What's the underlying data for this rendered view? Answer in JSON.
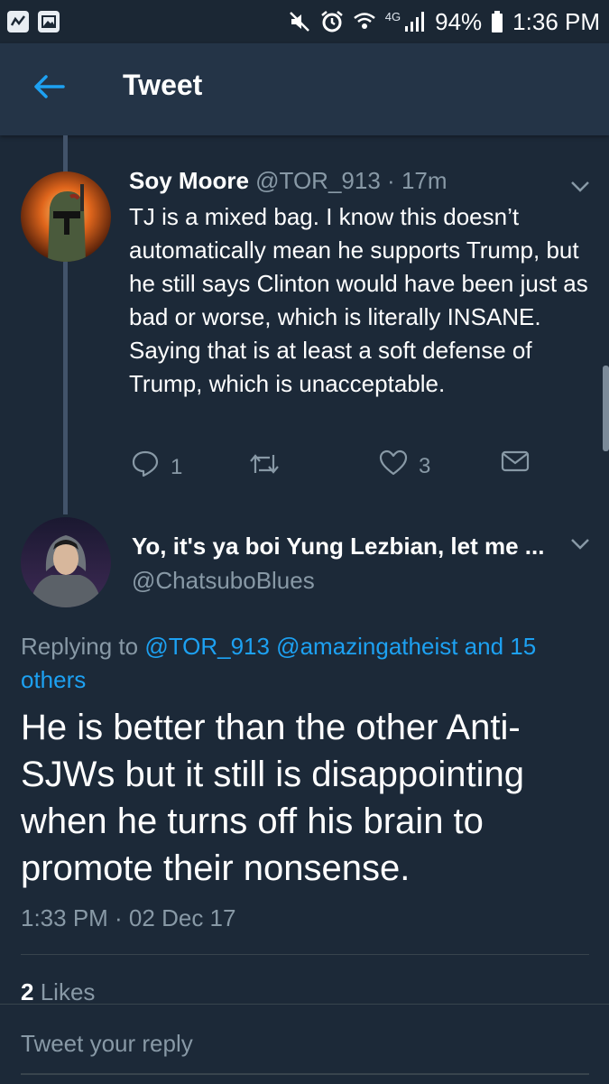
{
  "status_bar": {
    "network": "4G",
    "battery": "94%",
    "time": "1:36 PM",
    "icons": [
      "app-notification-icon",
      "image-notification-icon",
      "mute-icon",
      "alarm-icon",
      "wifi-icon",
      "signal-icon",
      "battery-icon"
    ]
  },
  "header": {
    "title": "Tweet",
    "back_icon": "back-arrow-icon"
  },
  "parent_tweet": {
    "name": "Soy Moore",
    "handle": "@TOR_913",
    "separator": "·",
    "time": "17m",
    "text": "TJ is a mixed bag. I know this doesn’t automatically mean he supports Trump, but he still says Clinton would have been just as bad or worse, which is literally INSANE. Saying that is at least a soft defense of Trump, which is unacceptable.",
    "reply_count": "1",
    "like_count": "3"
  },
  "main_tweet": {
    "name": "Yo, it's ya boi Yung Lezbian, let me ...",
    "handle": "@ChatsuboBlues",
    "replying_prefix": "Replying to",
    "replying_to": "@TOR_913 @amazingatheist and 15 others",
    "text": "He is better than the other Anti-SJWs but it still is disappointing when he turns off his brain to promote their nonsense.",
    "timestamp": "1:33 PM · 02 Dec 17",
    "likes_count": "2",
    "likes_label": "Likes"
  },
  "reply": {
    "placeholder": "Tweet your reply"
  },
  "colors": {
    "background": "#1c2938",
    "header": "#243447",
    "accent": "#1da1f2",
    "muted": "#8899a6",
    "divider": "#38444d"
  }
}
